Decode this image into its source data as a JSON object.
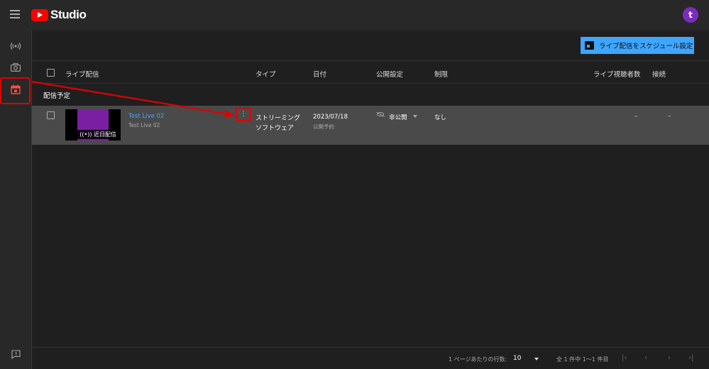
{
  "app": {
    "logo_text": "Studio",
    "avatar_letter": "t"
  },
  "sidebar": {
    "items": [
      {
        "icon": "live-icon",
        "active": false
      },
      {
        "icon": "camera-icon",
        "active": false
      },
      {
        "icon": "calendar-icon",
        "active": true
      },
      {
        "icon": "feedback-icon",
        "active": false
      }
    ]
  },
  "toolbar": {
    "schedule_label": "ライブ配信をスケジュール設定"
  },
  "table": {
    "headers": {
      "live": "ライブ配信",
      "type": "タイプ",
      "date": "日付",
      "visibility": "公開設定",
      "restriction": "制限",
      "viewers": "ライブ視聴者数",
      "connection": "接続"
    },
    "section_title": "配信予定",
    "rows": [
      {
        "title": "Test Live 02",
        "description": "Test Live 02",
        "badge": "近日配信",
        "type_line1": "ストリーミング",
        "type_line2": "ソフトウェア",
        "date": "2023/07/18",
        "date_sub": "公開予約",
        "visibility": "非公開",
        "restriction": "なし",
        "viewers": "–",
        "connection": "–"
      }
    ]
  },
  "footer": {
    "rows_per_page_label": "1 ページあたりの行数:",
    "rows_per_page_value": "10",
    "range_label": "全 1 件中 1〜1 件目"
  },
  "colors": {
    "accent": "#3ea6ff",
    "highlight": "#e00000",
    "brand": "#ff0000"
  }
}
